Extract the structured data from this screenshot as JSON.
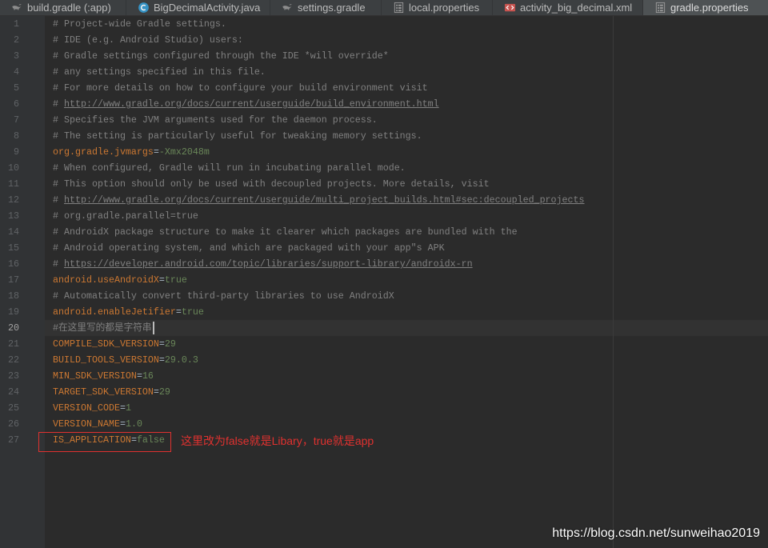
{
  "theme": {
    "editor_bg": "#2B2B2B",
    "gutter_bg": "#313335",
    "current_line_bg": "#323232",
    "tab_bar_bg": "#3C3F41",
    "active_tab_bg": "#4E5254",
    "tab_text": "#BBBBBB",
    "comment": "#808080",
    "key": "#CC7832",
    "sep": "#A9B7C6",
    "value": "#6A8759",
    "line_number": "#606366",
    "line_number_current": "#A4A3A3",
    "annotation_red": "#E0312F"
  },
  "tabs": [
    {
      "label": "build.gradle (:app)",
      "icon": "gradle-icon"
    },
    {
      "label": "BigDecimalActivity.java",
      "icon": "java-class-icon"
    },
    {
      "label": "settings.gradle",
      "icon": "gradle-icon"
    },
    {
      "label": "local.properties",
      "icon": "properties-file-icon"
    },
    {
      "label": "activity_big_decimal.xml",
      "icon": "xml-file-icon"
    },
    {
      "label": "gradle.properties",
      "icon": "properties-file-icon",
      "active": true
    }
  ],
  "editor": {
    "current_line": 20,
    "lines": [
      {
        "n": 1,
        "comment": "# Project-wide Gradle settings."
      },
      {
        "n": 2,
        "comment": "# IDE (e.g. Android Studio) users:"
      },
      {
        "n": 3,
        "comment": "# Gradle settings configured through the IDE *will override*"
      },
      {
        "n": 4,
        "comment": "# any settings specified in this file."
      },
      {
        "n": 5,
        "comment": "# For more details on how to configure your build environment visit"
      },
      {
        "n": 6,
        "comment": "# ",
        "link": "http://www.gradle.org/docs/current/userguide/build_environment.html"
      },
      {
        "n": 7,
        "comment": "# Specifies the JVM arguments used for the daemon process."
      },
      {
        "n": 8,
        "comment": "# The setting is particularly useful for tweaking memory settings."
      },
      {
        "n": 9,
        "key": "org.gradle.jvmargs",
        "sep": "=",
        "value": "-Xmx2048m"
      },
      {
        "n": 10,
        "comment": "# When configured, Gradle will run in incubating parallel mode."
      },
      {
        "n": 11,
        "comment": "# This option should only be used with decoupled projects. More details, visit"
      },
      {
        "n": 12,
        "comment": "# ",
        "link": "http://www.gradle.org/docs/current/userguide/multi_project_builds.html#sec:decoupled_projects"
      },
      {
        "n": 13,
        "comment": "# org.gradle.parallel=true"
      },
      {
        "n": 14,
        "comment": "# AndroidX package structure to make it clearer which packages are bundled with the"
      },
      {
        "n": 15,
        "comment": "# Android operating system, and which are packaged with your app\"s APK"
      },
      {
        "n": 16,
        "comment": "# ",
        "link": "https://developer.android.com/topic/libraries/support-library/androidx-rn"
      },
      {
        "n": 17,
        "key": "android.useAndroidX",
        "sep": "=",
        "value": "true"
      },
      {
        "n": 18,
        "comment": "# Automatically convert third-party libraries to use AndroidX"
      },
      {
        "n": 19,
        "key": "android.enableJetifier",
        "sep": "=",
        "value": "true"
      },
      {
        "n": 20,
        "comment": "#在这里写的都是字符串"
      },
      {
        "n": 21,
        "key": "COMPILE_SDK_VERSION",
        "sep": "=",
        "value": "29"
      },
      {
        "n": 22,
        "key": "BUILD_TOOLS_VERSION",
        "sep": "=",
        "value": "29.0.3"
      },
      {
        "n": 23,
        "key": "MIN_SDK_VERSION",
        "sep": "=",
        "value": "16"
      },
      {
        "n": 24,
        "key": "TARGET_SDK_VERSION",
        "sep": "=",
        "value": "29"
      },
      {
        "n": 25,
        "key": "VERSION_CODE",
        "sep": "=",
        "value": "1"
      },
      {
        "n": 26,
        "key": "VERSION_NAME",
        "sep": "=",
        "value": "1.0"
      },
      {
        "n": 27,
        "key": "IS_APPLICATION",
        "sep": "=",
        "value": "false"
      }
    ]
  },
  "annotation": {
    "text": "这里改为false就是Libary，true就是app"
  },
  "watermark": "https://blog.csdn.net/sunweihao2019"
}
